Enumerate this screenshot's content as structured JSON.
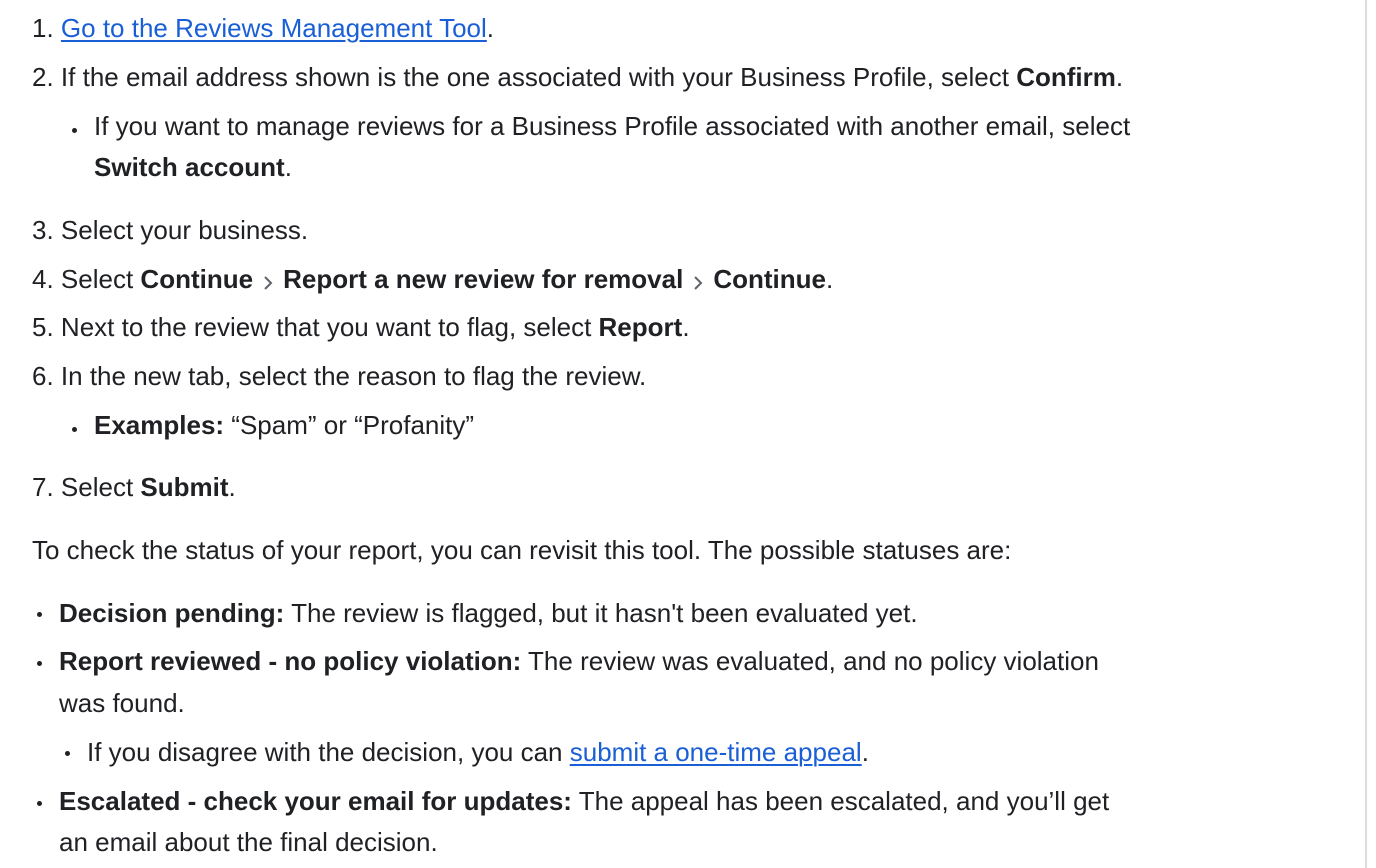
{
  "steps": {
    "s1_num": "1.",
    "s1_link": "Go to the Reviews Management Tool",
    "s1_end": ".",
    "s2_num": "2.",
    "s2_text": "If the email address shown is the one associated with your Business Profile, select ",
    "s2_bold": "Confirm",
    "s2_end": ".",
    "s2_sub_text": "If you want to manage reviews for a Business Profile associated with another email, select",
    "s2_sub_bold": "Switch account",
    "s2_sub_end": ".",
    "s3_num": "3.",
    "s3_text": "Select your business.",
    "s4_num": "4.",
    "s4_pre": "Select ",
    "s4_b1": "Continue",
    "s4_b2": "Report a new review for removal",
    "s4_b3": "Continue",
    "s4_end": ".",
    "s5_num": "5.",
    "s5_text": "Next to the review that you want to flag, select ",
    "s5_bold": "Report",
    "s5_end": ".",
    "s6_num": "6.",
    "s6_text": "In the new tab, select the reason to flag the review.",
    "s6_sub_bold": "Examples:",
    "s6_sub_text": " “Spam” or “Profanity”",
    "s7_num": "7.",
    "s7_pre": "Select ",
    "s7_bold": "Submit",
    "s7_end": "."
  },
  "status_intro": "To check the status of your report, you can revisit this tool. The possible statuses are:",
  "statuses": {
    "pending_label": "Decision pending:",
    "pending_text": " The review is flagged, but it hasn't been evaluated yet.",
    "reviewed_label": "Report reviewed - no policy violation:",
    "reviewed_text": " The review was evaluated, and no policy violation",
    "reviewed_text2": "was found.",
    "appeal_pre": "If you disagree with the decision, you can ",
    "appeal_link": "submit a one-time appeal",
    "appeal_end": ".",
    "escalated_label": "Escalated - check your email for updates:",
    "escalated_text": " The appeal has been escalated, and you’ll get",
    "escalated_text2": "an email about the final decision."
  },
  "icons": {
    "breadcrumb": "chevron-right-icon",
    "bullet": "bullet-dot"
  },
  "colors": {
    "text": "#202124",
    "link": "#1a5fd6",
    "chevron": "#5f6368",
    "divider": "#dadce0"
  }
}
